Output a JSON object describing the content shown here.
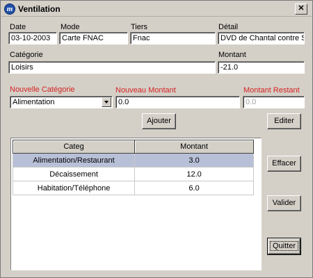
{
  "window": {
    "title": "Ventilation",
    "app_icon": "m"
  },
  "header_fields": {
    "date": {
      "label": "Date",
      "value": "03-10-2003"
    },
    "mode": {
      "label": "Mode",
      "value": "Carte FNAC"
    },
    "tiers": {
      "label": "Tiers",
      "value": "Fnac"
    },
    "detail": {
      "label": "Détail",
      "value": "DVD de Chantal contre Sp"
    },
    "categorie": {
      "label": "Catégorie",
      "value": "Loisirs"
    },
    "montant": {
      "label": "Montant",
      "value": "-21.0"
    }
  },
  "new_entry": {
    "nouvelle_categorie": {
      "label": "Nouvelle Catégorie",
      "value": "Alimentation"
    },
    "nouveau_montant": {
      "label": "Nouveau Montant",
      "value": "0.0"
    },
    "montant_restant": {
      "label": "Montant Restant",
      "value": "0.0"
    }
  },
  "buttons": {
    "ajouter": "Ajouter",
    "editer": "Editer",
    "effacer": "Effacer",
    "valider": "Valider",
    "quitter": "Quitter"
  },
  "table": {
    "headers": [
      "Categ",
      "Montant"
    ],
    "rows": [
      {
        "categ": "Alimentation/Restaurant",
        "montant": "3.0",
        "selected": true
      },
      {
        "categ": "Décaissement",
        "montant": "12.0",
        "selected": false
      },
      {
        "categ": "Habitation/Téléphone",
        "montant": "6.0",
        "selected": false
      }
    ]
  },
  "colors": {
    "window_bg": "#d4d0c8",
    "red_label": "#d62121",
    "selection": "#b8c0d8"
  }
}
